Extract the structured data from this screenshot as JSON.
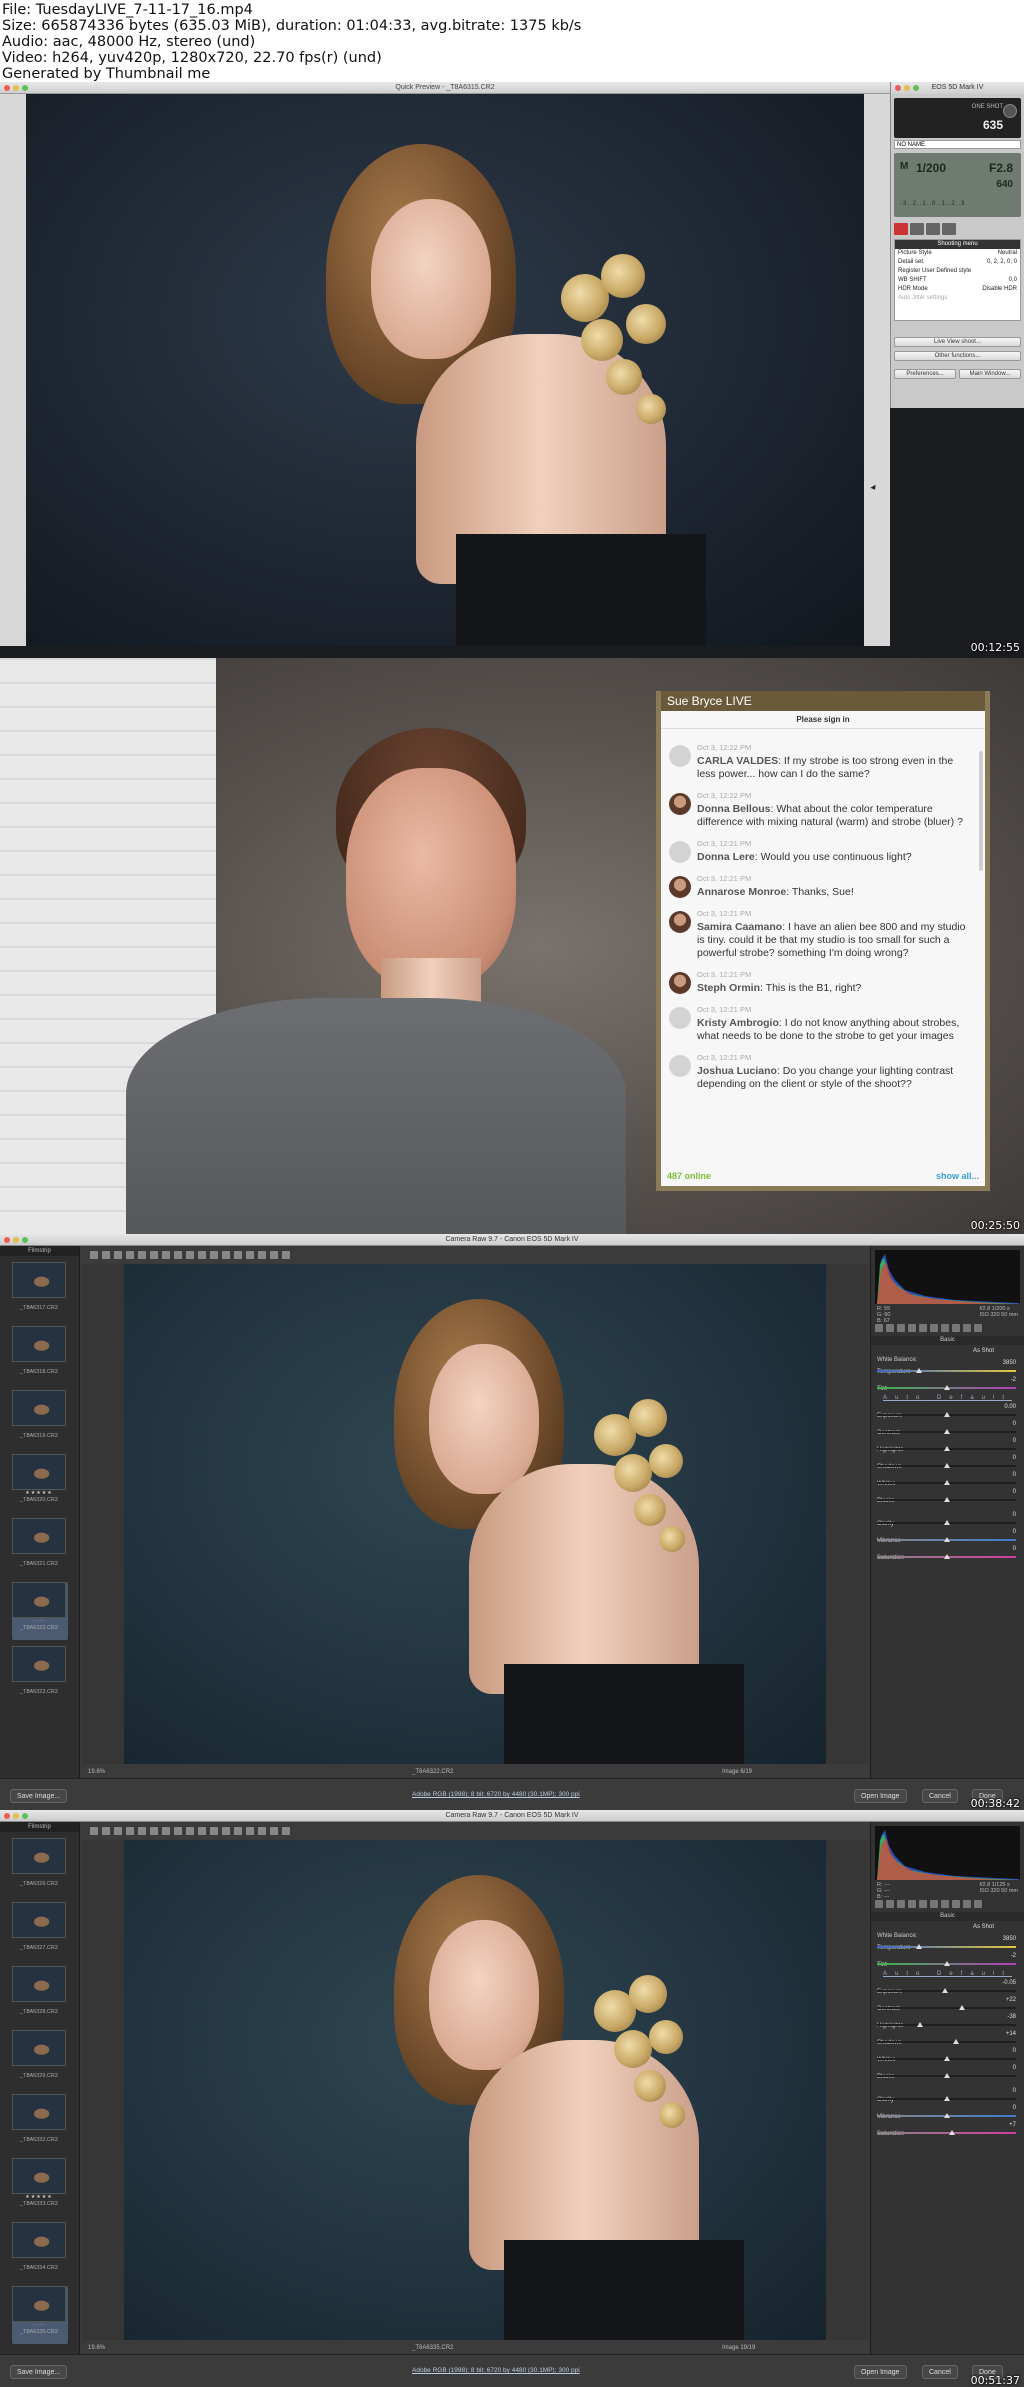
{
  "header": {
    "lines": [
      "File: TuesdayLIVE_7-11-17_16.mp4",
      "Size: 665874336 bytes (635.03 MiB), duration: 01:04:33, avg.bitrate: 1375 kb/s",
      "Audio: aac, 48000 Hz, stereo (und)",
      "Video: h264, yuv420p, 1280x720, 22.70 fps(r) (und)",
      "Generated by Thumbnail me"
    ]
  },
  "frame1": {
    "timestamp": "00:12:55",
    "window_title": "Quick Preview - _T8A6315.CR2",
    "eos": {
      "title": "EOS 5D Mark IV",
      "lcd_small": "ONE SHOT",
      "lcd_big": "635",
      "card_name": "NO NAME",
      "shutter": "1/200",
      "aperture": "F2.8",
      "iso": "640",
      "mode": "M",
      "scale": "-3..2..1..0..1..2..3",
      "menu_header": "Shooting menu",
      "menu_rows": [
        {
          "label": "Picture Style",
          "value": "Neutral"
        },
        {
          "label": "Detail set.",
          "value": "0, 2, 2, 0, 0"
        },
        {
          "label": "Register User Defined style",
          "value": ""
        },
        {
          "label": "WB SHIFT",
          "value": "0,0"
        },
        {
          "label": "HDR Mode",
          "value": "Disable HDR"
        },
        {
          "label": "Auto Jitter settings",
          "value": ""
        }
      ],
      "live_view_btn": "Live View shoot...",
      "other_btn": "Other functions...",
      "prefs_btn": "Preferences...",
      "main_btn": "Main Window..."
    }
  },
  "frame2": {
    "timestamp": "00:25:50",
    "chat_title": "Sue Bryce LIVE",
    "sign_in": "Please sign in",
    "messages": [
      {
        "time": "Oct 3, 12:22 PM",
        "name": "CARLA VALDES",
        "text": ": If my strobe is too strong even in the less power... how can I do the same?",
        "photo": false
      },
      {
        "time": "Oct 3, 12:22 PM",
        "name": "Donna Bellous",
        "text": ": What about the color temperature difference with mixing natural (warm) and strobe (bluer) ?",
        "photo": true
      },
      {
        "time": "Oct 3, 12:21 PM",
        "name": "Donna Lere",
        "text": ": Would you use continuous light?",
        "photo": false
      },
      {
        "time": "Oct 3, 12:21 PM",
        "name": "Annarose Monroe",
        "text": ": Thanks, Sue!",
        "photo": true
      },
      {
        "time": "Oct 3, 12:21 PM",
        "name": "Samira Caamano",
        "text": ": I have an alien bee 800 and my studio is tiny. could it be that my studio is too small for such a powerful strobe? something I'm doing wrong?",
        "photo": true
      },
      {
        "time": "Oct 3, 12:21 PM",
        "name": "Steph Ormin",
        "text": ": This is the B1, right?",
        "photo": true
      },
      {
        "time": "Oct 3, 12:21 PM",
        "name": "Kristy Ambrogio",
        "text": ": I do not know anything about strobes, what needs to be done to the strobe to get your images",
        "photo": false
      },
      {
        "time": "Oct 3, 12:21 PM",
        "name": "Joshua Luciano",
        "text": ": Do you change your lighting contrast depending on the client or style of the shoot??",
        "photo": false
      }
    ],
    "online": "487 online",
    "show_all": "show all..."
  },
  "frame3": {
    "timestamp": "00:38:42",
    "title": "Camera Raw 9.7  -  Canon EOS 5D Mark IV",
    "filmstrip_label": "Filmstrip",
    "thumbs": [
      {
        "name": "_T8A6317.CR2",
        "stars": "",
        "selected": false
      },
      {
        "name": "_T8A6318.CR2",
        "stars": "",
        "selected": false
      },
      {
        "name": "_T8A6319.CR2",
        "stars": "",
        "selected": false
      },
      {
        "name": "_T8A6320.CR2",
        "stars": "★★★★★",
        "selected": false
      },
      {
        "name": "_T8A6321.CR2",
        "stars": "",
        "selected": false
      },
      {
        "name": "_T8A6322.CR2",
        "stars": "·····",
        "selected": true
      },
      {
        "name": "_T8A6323.CR2",
        "stars": "",
        "selected": false
      }
    ],
    "zoom": "19.8%",
    "filename": "_T8A6322.CR2",
    "image_counter": "Image 6/19",
    "rgb": {
      "r": "R:  55",
      "g": "G:  60",
      "b": "B:  67",
      "info1": "f/2.8   1/200 s",
      "info2": "ISO 320   50 mm"
    },
    "white_balance": {
      "label": "White Balance:",
      "value": "As Shot"
    },
    "sliders": [
      {
        "label": "Temperature",
        "value": "3850",
        "track": "temp",
        "pos": 0.3
      },
      {
        "label": "Tint",
        "value": "-2",
        "track": "tint",
        "pos": 0.5
      },
      {
        "label": "Exposure",
        "value": "0.00",
        "track": "",
        "pos": 0.5
      },
      {
        "label": "Contrast",
        "value": "0",
        "track": "",
        "pos": 0.5
      },
      {
        "label": "Highlights",
        "value": "0",
        "track": "",
        "pos": 0.5
      },
      {
        "label": "Shadows",
        "value": "0",
        "track": "",
        "pos": 0.5
      },
      {
        "label": "Whites",
        "value": "0",
        "track": "",
        "pos": 0.5
      },
      {
        "label": "Blacks",
        "value": "0",
        "track": "",
        "pos": 0.5
      },
      {
        "label": "Clarity",
        "value": "0",
        "track": "",
        "pos": 0.5
      },
      {
        "label": "Vibrance",
        "value": "0",
        "track": "vib",
        "pos": 0.5
      },
      {
        "label": "Saturation",
        "value": "0",
        "track": "sat",
        "pos": 0.5
      }
    ],
    "auto": "Auto",
    "default": "Default",
    "basic": "Basic",
    "save_btn": "Save Image...",
    "workflow_link": "Adobe RGB (1998); 8 bit; 6720 by 4480 (30.1MP); 300 ppi",
    "open_btn": "Open Image",
    "cancel_btn": "Cancel",
    "done_btn": "Done"
  },
  "frame4": {
    "timestamp": "00:51:37",
    "title": "Camera Raw 9.7  -  Canon EOS 5D Mark IV",
    "filmstrip_label": "Filmstrip",
    "thumbs": [
      {
        "name": "_T8A6326.CR2",
        "stars": "",
        "selected": false
      },
      {
        "name": "_T8A6327.CR2",
        "stars": "",
        "selected": false
      },
      {
        "name": "_T8A6328.CR2",
        "stars": "",
        "selected": false
      },
      {
        "name": "_T8A6329.CR2",
        "stars": "",
        "selected": false
      },
      {
        "name": "_T8A6332.CR2",
        "stars": "",
        "selected": false
      },
      {
        "name": "_T8A6333.CR2",
        "stars": "★★★★★",
        "selected": false
      },
      {
        "name": "_T8A6334.CR2",
        "stars": "",
        "selected": false
      },
      {
        "name": "_T8A6335.CR2",
        "stars": "·····",
        "selected": true
      }
    ],
    "zoom": "19.8%",
    "filename": "_T8A6335.CR2",
    "image_counter": "Image 19/19",
    "rgb": {
      "r": "R:  ---",
      "g": "G:  ---",
      "b": "B:  ---",
      "info1": "f/2.8   1/125 s",
      "info2": "ISO 320   50 mm"
    },
    "white_balance": {
      "label": "White Balance:",
      "value": "As Shot"
    },
    "sliders": [
      {
        "label": "Temperature",
        "value": "3850",
        "track": "temp",
        "pos": 0.3
      },
      {
        "label": "Tint",
        "value": "-2",
        "track": "tint",
        "pos": 0.5
      },
      {
        "label": "Exposure",
        "value": "-0.05",
        "track": "",
        "pos": 0.49
      },
      {
        "label": "Contrast",
        "value": "+22",
        "track": "",
        "pos": 0.61
      },
      {
        "label": "Highlights",
        "value": "-38",
        "track": "",
        "pos": 0.31
      },
      {
        "label": "Shadows",
        "value": "+14",
        "track": "",
        "pos": 0.57
      },
      {
        "label": "Whites",
        "value": "0",
        "track": "",
        "pos": 0.5
      },
      {
        "label": "Blacks",
        "value": "0",
        "track": "",
        "pos": 0.5
      },
      {
        "label": "Clarity",
        "value": "0",
        "track": "",
        "pos": 0.5
      },
      {
        "label": "Vibrance",
        "value": "0",
        "track": "vib",
        "pos": 0.5
      },
      {
        "label": "Saturation",
        "value": "+7",
        "track": "sat",
        "pos": 0.54
      }
    ],
    "auto": "Auto",
    "default": "Default",
    "basic": "Basic",
    "save_btn": "Save Image...",
    "workflow_link": "Adobe RGB (1998); 8 bit; 6720 by 4480 (30.1MP); 300 ppi",
    "open_btn": "Open Image",
    "cancel_btn": "Cancel",
    "done_btn": "Done"
  }
}
